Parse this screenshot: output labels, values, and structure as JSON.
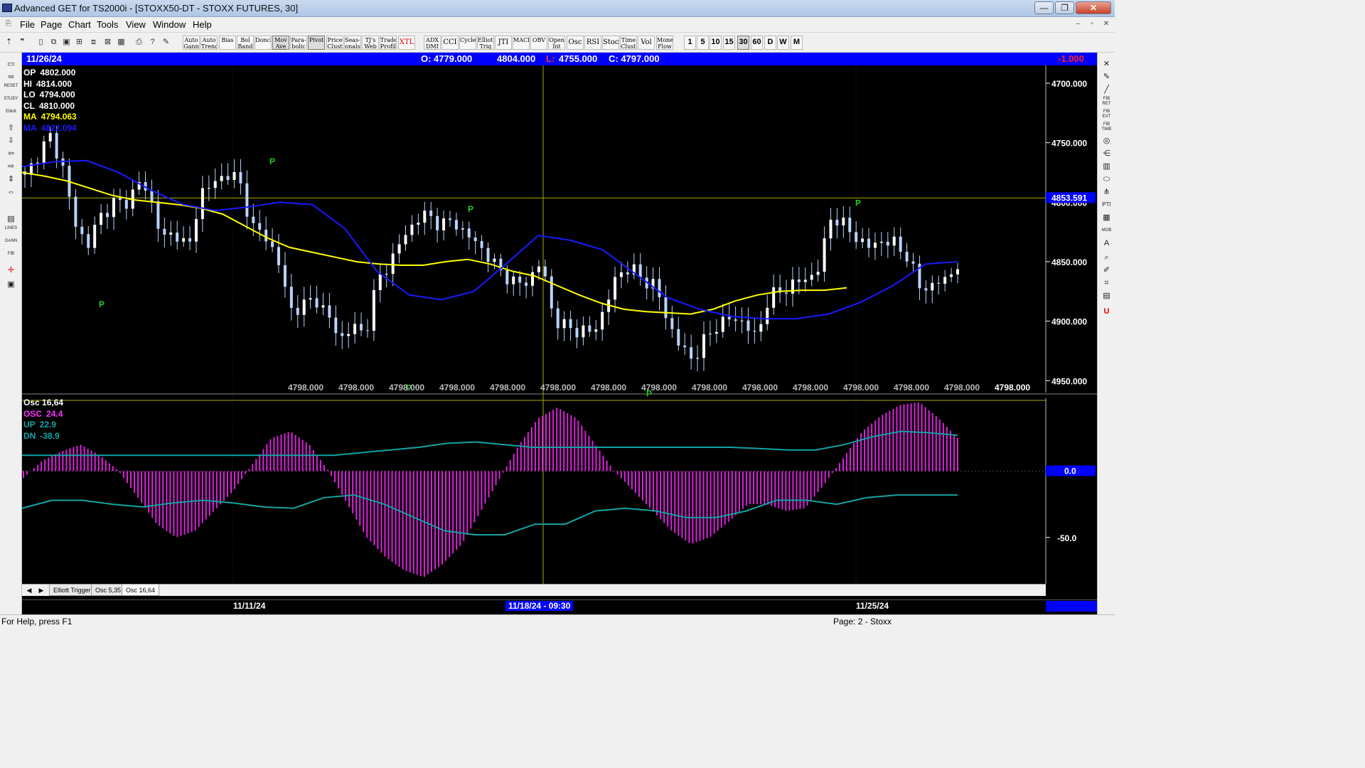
{
  "window": {
    "title": "Advanced GET for TS2000i - [STOXX50-DT - STOXX FUTURES, 30]",
    "min_glyph": "—",
    "max_glyph": "❐",
    "close_glyph": "✕"
  },
  "menu": [
    "File",
    "Page",
    "Chart",
    "Tools",
    "View",
    "Window",
    "Help"
  ],
  "mdi_controls": [
    "–",
    "▫",
    "✕"
  ],
  "toolbar": {
    "studies": [
      "Auto Gann",
      "Auto Trend",
      "Bias",
      "Bol Band",
      "Donch",
      "Mov Ave",
      "Para- bolic",
      "Pivot",
      "Price Clust",
      "Seas- onals",
      "TJ's Web",
      "Trade Profile",
      "XTL"
    ],
    "indicators": [
      "ADX DMI",
      "CCI",
      "Cycles",
      "Elliott Trig",
      "JTI",
      "MACD",
      "OBV",
      "Open Int",
      "Osc",
      "RSI",
      "Stoch",
      "Time Clust",
      "Vol",
      "Money Flow"
    ],
    "intervals": [
      "1",
      "5",
      "10",
      "15",
      "30",
      "60",
      "D",
      "W",
      "M"
    ],
    "active_interval": "30"
  },
  "info_bar": {
    "date": "11/26/24",
    "open": "O: 4779.000",
    "high": "4804.000",
    "low_prefix": "L:",
    "low": "4755.000",
    "close": "C: 4797.000",
    "change": "-1.000"
  },
  "price_stats": [
    {
      "label": "OP",
      "value": "4802.000",
      "color": "#ffffff"
    },
    {
      "label": "HI",
      "value": "4814.000",
      "color": "#ffffff"
    },
    {
      "label": "LO",
      "value": "4794.000",
      "color": "#ffffff"
    },
    {
      "label": "CL",
      "value": "4810.000",
      "color": "#ffffff"
    },
    {
      "label": "MA",
      "value": "4794.063",
      "color": "#ffff00"
    },
    {
      "label": "MA",
      "value": "4822.094",
      "color": "#1a1aff"
    }
  ],
  "price_axis": {
    "ticks": [
      "4950.000",
      "4900.000",
      "4850.000",
      "4800.000",
      "4750.000",
      "4700.000"
    ],
    "cursor_price": "4853.591",
    "cursor_axis_value": "4798.000"
  },
  "cursor_row_labels": [
    "4798.000",
    "4798.000",
    "4798.000",
    "4798.000",
    "4798.000",
    "4798.000",
    "4798.000",
    "4798.000",
    "4798.000",
    "4798.000",
    "4798.000",
    "4798.000",
    "4798.000",
    "4798.000"
  ],
  "pivot_label": "P",
  "osc_stats": [
    {
      "label": "Osc 16,64",
      "value": "",
      "color": "#ffffff"
    },
    {
      "label": "OSC",
      "value": "24.4",
      "color": "#ff33ff"
    },
    {
      "label": "UP",
      "value": "22.9",
      "color": "#14a3a3"
    },
    {
      "label": "DN",
      "value": "-38.9",
      "color": "#14a3a3"
    }
  ],
  "osc_axis": {
    "ticks": [
      "0.0",
      "-50.0"
    ]
  },
  "tabs": [
    {
      "label": "Elliott Trigger",
      "active": false
    },
    {
      "label": "Osc 5,35",
      "active": false
    },
    {
      "label": "Osc 16,64",
      "active": true
    }
  ],
  "date_axis": {
    "labels": [
      "11/11/24",
      "11/25/24"
    ],
    "cursor_label": "11/18/24 - 09:30"
  },
  "status": {
    "left": "For Help, press F1",
    "right": "Page: 2 - Stoxx"
  },
  "chart_data": [
    {
      "type": "candlestick",
      "title": "STOXX50-DT - STOXX FUTURES, 30",
      "ylim": [
        4690,
        4965
      ],
      "y_ticks": [
        4700,
        4750,
        4800,
        4850,
        4900,
        4950
      ],
      "x_date_labels": [
        "11/11/24",
        "11/18/24 - 09:30",
        "11/25/24"
      ],
      "grid": true,
      "series": [
        {
          "name": "Price",
          "close_path": [
            4870,
            4890,
            4905,
            4880,
            4830,
            4815,
            4838,
            4850,
            4848,
            4868,
            4852,
            4818,
            4825,
            4810,
            4860,
            4865,
            4875,
            4868,
            4830,
            4822,
            4805,
            4760,
            4762,
            4770,
            4755,
            4735,
            4745,
            4740,
            4785,
            4800,
            4820,
            4835,
            4840,
            4830,
            4835,
            4822,
            4815,
            4800,
            4790,
            4780,
            4785,
            4800,
            4750,
            4745,
            4742,
            4740,
            4760,
            4790,
            4795,
            4785,
            4780,
            4750,
            4728,
            4718,
            4735,
            4748,
            4752,
            4750,
            4735,
            4770,
            4775,
            4782,
            4785,
            4795,
            4840,
            4830,
            4820,
            4812,
            4818,
            4815,
            4805,
            4778,
            4780,
            4785,
            4797
          ]
        },
        {
          "name": "MA",
          "values": [
            4875,
            4872,
            4868,
            4862,
            4856,
            4852,
            4850,
            4848,
            4845,
            4840,
            4830,
            4820,
            4812,
            4808,
            4804,
            4800,
            4798,
            4797,
            4797,
            4800,
            4802,
            4798,
            4792,
            4788,
            4780,
            4772,
            4765,
            4760,
            4758,
            4757,
            4756,
            4760,
            4767,
            4772,
            4775,
            4776,
            4776,
            4778
          ]
        },
        {
          "name": "MA",
          "values": [
            4880,
            4884,
            4885,
            4875,
            4860,
            4848,
            4843,
            4846,
            4850,
            4848,
            4828,
            4792,
            4772,
            4768,
            4775,
            4798,
            4822,
            4818,
            4810,
            4790,
            4770,
            4760,
            4754,
            4752,
            4752,
            4756,
            4766,
            4780,
            4798,
            4800
          ]
        }
      ],
      "pivots": [
        "P",
        "P",
        "P",
        "P",
        "P",
        "P",
        "P"
      ],
      "cursor_price": 4853.591
    },
    {
      "type": "bar",
      "title": "Osc 16,64",
      "ylim": [
        -85,
        55
      ],
      "y_ticks": [
        0,
        -50
      ],
      "series": [
        {
          "name": "OSC",
          "values": [
            -5,
            8,
            15,
            20,
            12,
            0,
            -20,
            -40,
            -50,
            -45,
            -30,
            -15,
            5,
            25,
            30,
            20,
            0,
            -25,
            -50,
            -65,
            -75,
            -80,
            -70,
            -55,
            -30,
            -5,
            20,
            40,
            48,
            40,
            20,
            0,
            -15,
            -30,
            -45,
            -55,
            -50,
            -38,
            -25,
            -25,
            -30,
            -28,
            -10,
            10,
            30,
            42,
            50,
            52,
            40,
            25
          ]
        },
        {
          "name": "UP",
          "values": [
            12,
            12,
            12,
            12,
            12,
            12,
            12,
            12,
            12,
            12,
            12,
            12,
            14,
            16,
            18,
            21,
            22,
            20,
            18,
            18,
            18,
            18,
            18,
            18,
            18,
            18,
            17,
            16,
            16,
            20,
            26,
            30,
            29,
            27
          ]
        },
        {
          "name": "DN",
          "values": [
            -28,
            -22,
            -22,
            -25,
            -27,
            -24,
            -22,
            -24,
            -27,
            -28,
            -20,
            -18,
            -25,
            -35,
            -45,
            -48,
            -48,
            -40,
            -40,
            -30,
            -28,
            -30,
            -35,
            -35,
            -30,
            -22,
            -22,
            -25,
            -20,
            -18,
            -18,
            -18
          ]
        }
      ]
    }
  ]
}
